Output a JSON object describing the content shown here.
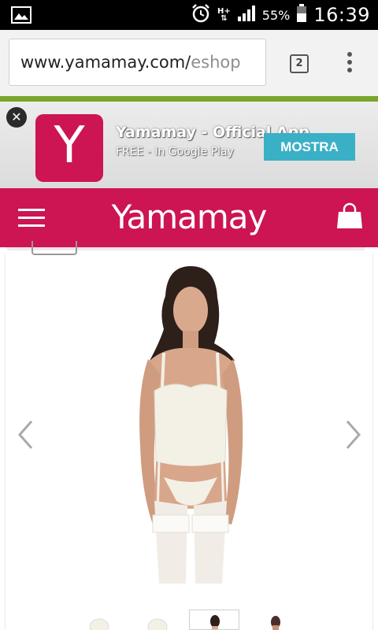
{
  "status_bar": {
    "network_type": "H+",
    "battery_percent": "55%",
    "time": "16:39"
  },
  "browser": {
    "url_main": "www.yamamay.com/",
    "url_rest": "eshop",
    "tab_count": "2"
  },
  "app_banner": {
    "app_name": "Yamamay - Official App",
    "subtitle": "FREE - In Google Play",
    "action_label": "MOSTRA",
    "icon_letter": "Y"
  },
  "site_header": {
    "logo_text": "Yamamay"
  },
  "colors": {
    "brand": "#cc1552",
    "banner_button": "#3ab0c7",
    "progress_line": "#79a52c"
  }
}
